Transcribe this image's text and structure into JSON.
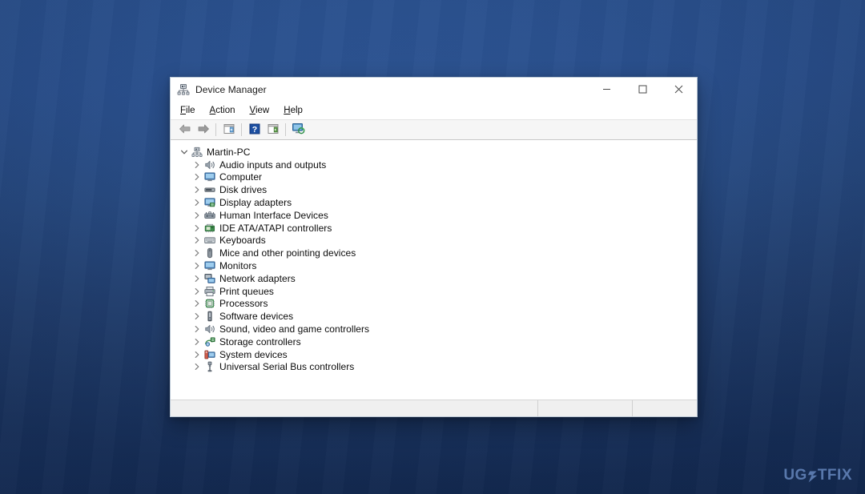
{
  "desktop": {
    "wallpaper_name": "windows-blue-gradient-wallpaper",
    "colors": {
      "top": "#2c5391",
      "bottom": "#142b52",
      "accent": "#5f7fb4"
    }
  },
  "window": {
    "title": "Device Manager",
    "title_icon": "device-manager-icon",
    "controls": {
      "minimize": "—",
      "maximize": "☐",
      "close": "✕"
    },
    "menubar": [
      {
        "label": "File",
        "accesskey": "F"
      },
      {
        "label": "Action",
        "accesskey": "A"
      },
      {
        "label": "View",
        "accesskey": "V"
      },
      {
        "label": "Help",
        "accesskey": "H"
      }
    ],
    "toolbar": [
      {
        "name": "back-arrow-icon",
        "title": "Back"
      },
      {
        "name": "forward-arrow-icon",
        "title": "Forward"
      },
      {
        "name": "separator-1",
        "title": ""
      },
      {
        "name": "show-hide-console-tree-icon",
        "title": "Show/Hide Console Tree"
      },
      {
        "name": "separator-2",
        "title": ""
      },
      {
        "name": "help-icon",
        "title": "Help"
      },
      {
        "name": "properties-icon",
        "title": "Properties"
      },
      {
        "name": "separator-3",
        "title": ""
      },
      {
        "name": "scan-hardware-changes-icon",
        "title": "Scan for hardware changes"
      }
    ],
    "tree": {
      "root": {
        "label": "Martin-PC",
        "icon": "computer-tree-root-icon",
        "expanded": true
      },
      "children": [
        {
          "label": "Audio inputs and outputs",
          "icon": "speaker-icon",
          "expanded": false
        },
        {
          "label": "Computer",
          "icon": "monitor-icon",
          "expanded": false
        },
        {
          "label": "Disk drives",
          "icon": "disk-drive-icon",
          "expanded": false
        },
        {
          "label": "Display adapters",
          "icon": "display-adapter-icon",
          "expanded": false
        },
        {
          "label": "Human Interface Devices",
          "icon": "hid-icon",
          "expanded": false
        },
        {
          "label": "IDE ATA/ATAPI controllers",
          "icon": "ide-controller-icon",
          "expanded": false
        },
        {
          "label": "Keyboards",
          "icon": "keyboard-icon",
          "expanded": false
        },
        {
          "label": "Mice and other pointing devices",
          "icon": "mouse-icon",
          "expanded": false
        },
        {
          "label": "Monitors",
          "icon": "monitor-icon",
          "expanded": false
        },
        {
          "label": "Network adapters",
          "icon": "network-adapter-icon",
          "expanded": false
        },
        {
          "label": "Print queues",
          "icon": "printer-icon",
          "expanded": false
        },
        {
          "label": "Processors",
          "icon": "processor-icon",
          "expanded": false
        },
        {
          "label": "Software devices",
          "icon": "software-device-icon",
          "expanded": false
        },
        {
          "label": "Sound, video and game controllers",
          "icon": "speaker-icon",
          "expanded": false
        },
        {
          "label": "Storage controllers",
          "icon": "storage-controller-icon",
          "expanded": false
        },
        {
          "label": "System devices",
          "icon": "system-device-icon",
          "expanded": false
        },
        {
          "label": "Universal Serial Bus controllers",
          "icon": "usb-icon",
          "expanded": false
        }
      ]
    },
    "statusbar": {
      "pane1": "",
      "pane2": "",
      "pane3": ""
    }
  },
  "watermark": {
    "prefix": "UG",
    "bolt_icon": "lightning-bolt-icon",
    "suffix": "TFIX"
  }
}
